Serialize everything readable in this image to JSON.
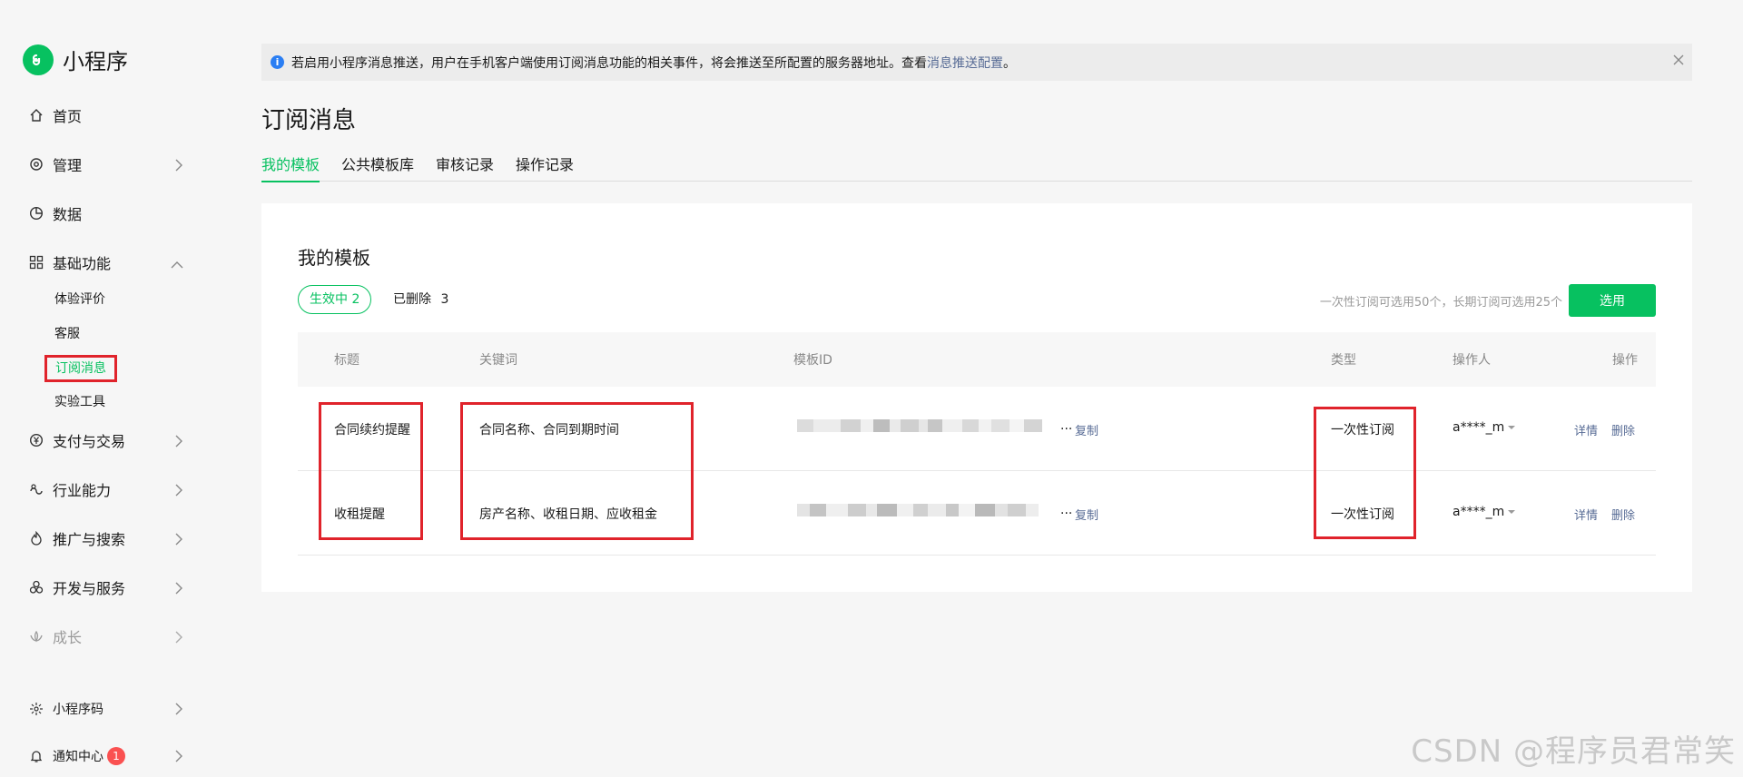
{
  "app": {
    "name": "小程序"
  },
  "sidebar": {
    "items": [
      {
        "label": "首页"
      },
      {
        "label": "管理"
      },
      {
        "label": "数据"
      },
      {
        "label": "基础功能"
      },
      {
        "label": "支付与交易"
      },
      {
        "label": "行业能力"
      },
      {
        "label": "推广与搜索"
      },
      {
        "label": "开发与服务"
      },
      {
        "label": "成长"
      },
      {
        "label": "小程序码"
      },
      {
        "label": "通知中心",
        "badge": "1"
      }
    ],
    "sub_items": [
      {
        "label": "体验评价"
      },
      {
        "label": "客服"
      },
      {
        "label": "订阅消息"
      },
      {
        "label": "实验工具"
      }
    ]
  },
  "notice": {
    "text": "若启用小程序消息推送，用户在手机客户端使用订阅消息功能的相关事件，将会推送至所配置的服务器地址。查看",
    "link": "消息推送配置",
    "end": "。"
  },
  "page_title": "订阅消息",
  "tabs": [
    {
      "label": "我的模板"
    },
    {
      "label": "公共模板库"
    },
    {
      "label": "审核记录"
    },
    {
      "label": "操作记录"
    }
  ],
  "card": {
    "title": "我的模板",
    "active_filter": "生效中",
    "active_count": "2",
    "deleted_filter": "已删除",
    "deleted_count": "3",
    "quota": "一次性订阅可选用50个，长期订阅可选用25个",
    "select_button": "选用"
  },
  "table": {
    "headers": {
      "title": "标题",
      "keywords": "关键词",
      "template_id": "模板ID",
      "type": "类型",
      "operator": "操作人",
      "actions": "操作"
    },
    "rows": [
      {
        "title": "合同续约提醒",
        "keywords": "合同名称、合同到期时间",
        "id_suffix": "...",
        "copy": "复制",
        "type": "一次性订阅",
        "operator": "a****_m",
        "detail": "详情",
        "delete": "删除"
      },
      {
        "title": "收租提醒",
        "keywords": "房产名称、收租日期、应收租金",
        "id_suffix": "...",
        "copy": "复制",
        "type": "一次性订阅",
        "operator": "a****_m",
        "detail": "详情",
        "delete": "删除"
      }
    ]
  },
  "watermark": "CSDN @程序员君常笑",
  "colors": {
    "accent": "#07c160",
    "link": "#576b95",
    "highlight": "#e0232b",
    "badge": "#fa5151"
  }
}
